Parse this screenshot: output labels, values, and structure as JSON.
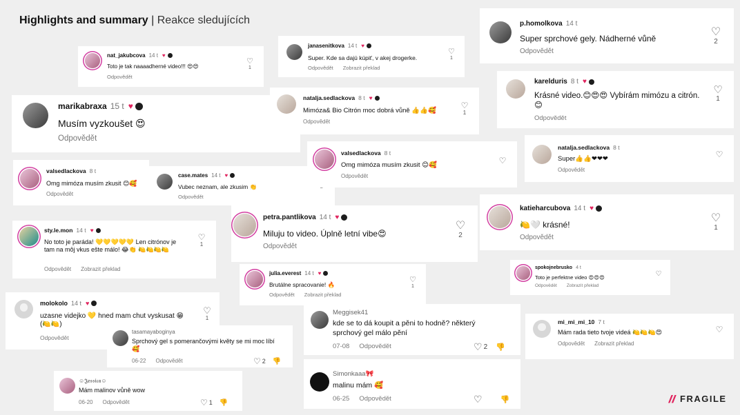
{
  "title": {
    "bold": "Highlights and summary",
    "sep": " | ",
    "sub": "Reakce sledujících"
  },
  "labels": {
    "reply": "Odpovědět",
    "translate": "Zobrazit překlad"
  },
  "icons": {
    "like": "heart-outline-icon",
    "dislike": "thumb-down-icon",
    "verified_heart": "heart-icon"
  },
  "comments": [
    {
      "user": "nat_jakubcova",
      "time": "14 t",
      "text": "Toto je tak naaaadherné video!!! 😍😍",
      "likes": "1"
    },
    {
      "user": "marikabraxa",
      "time": "15 t",
      "text": "Musím vyzkoušet 😍"
    },
    {
      "user": "valsedlackova",
      "time": "8 t",
      "text": "Omg mimóza musím zkusit 😊🥰"
    },
    {
      "user": "case.mates",
      "time": "14 t",
      "text": "Vubec neznam, ale zkusim 👏",
      "likes": "2"
    },
    {
      "user": "sty.le.mon",
      "time": "14 t",
      "text": "No toto je paráda! 💛💛💛💛💛 Len citrónov je tam na môj vkus ešte málo! 😂👏 🍋🍋🍋🍋",
      "likes": "1"
    },
    {
      "user": "molokolo",
      "time": "14 t",
      "text": "uzasne videjko 💛 hned mam chut vyskusat 😁 (🍋🍋)",
      "likes": "1"
    },
    {
      "user": "tasamayaboginya",
      "text": "Sprchový gel s pomerančovými květy se mi moc líbí 🥰",
      "date": "06-22",
      "likes": "2"
    },
    {
      "user": "☺𝕵𝖊𝖘𝖘𝖎𝖈𝖆☺",
      "text": "Mám malinov vůně wow",
      "date": "06-20",
      "likes": "1"
    },
    {
      "user": "janasenitkova",
      "time": "14 t",
      "text": "Super. Kde sa dajú kúpiť, v akej drogerke.",
      "likes": "1"
    },
    {
      "user": "natalja.sedlackova",
      "time": "8 t",
      "text": "Mimóza& Bio Citrón moc dobrá vůně 👍👍🥰",
      "likes": "1"
    },
    {
      "user": "valsedlackova",
      "time": "8 t",
      "text": "Omg mimóza musím zkusit 😊🥰"
    },
    {
      "user": "petra.pantlikova",
      "time": "14 t",
      "text": "Miluju to video. Úplně letní vibe😍",
      "likes": "2"
    },
    {
      "user": "julia.everest",
      "time": "14 t",
      "text": "Brutálne spracovanie! 🔥",
      "likes": "1"
    },
    {
      "user": "Meggisek41",
      "text": "kde se to dá koupit a pěni to hodně? některý sprchový gel málo pění",
      "date": "07-08",
      "likes": "2"
    },
    {
      "user": "Simonkaaa🎀",
      "text": "malinu mám 🥰",
      "date": "06-25"
    },
    {
      "user": "p.homolkova",
      "time": "14 t",
      "text": "Super sprchové gely. Nádherné vůně",
      "likes": "2"
    },
    {
      "user": "karelduris",
      "time": "8 t",
      "text": "Krásné video.😊😍😍 Vybírám mimózu a citrón.😊",
      "likes": "1"
    },
    {
      "user": "natalja.sedlackova",
      "time": "8 t",
      "text": "Super👍👍❤❤❤"
    },
    {
      "user": "katieharcubova",
      "time": "14 t",
      "text": "🍋🤍 krásné!",
      "likes": "1"
    },
    {
      "user": "spokojnebrusko",
      "time": "4 t",
      "text": "Toto je perfektne video 😍😍😍"
    },
    {
      "user": "mi_mi_mi_10",
      "time": "7 t",
      "text": "Mám rada tieto tvoje videá 🍋🍋🍋😍"
    }
  ],
  "logo": {
    "text": "FRAGILE"
  }
}
